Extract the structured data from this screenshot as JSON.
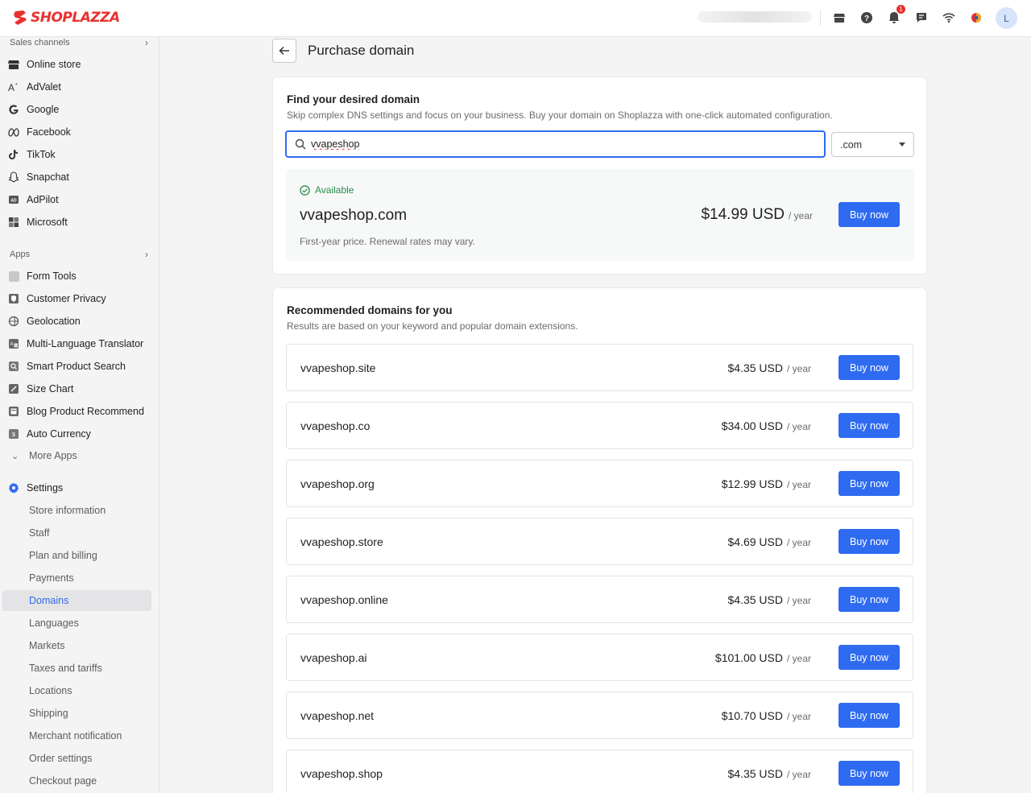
{
  "brand": {
    "name": "SHOPLAZZA",
    "color": "#e8312f"
  },
  "topbar": {
    "icons": [
      "storefront-icon",
      "help-icon",
      "bell-icon",
      "chat-icon",
      "wifi-icon",
      "theme-icon"
    ],
    "notification_count": "1",
    "avatar_initial": "L"
  },
  "sidebar": {
    "sales_channels_label": "Sales channels",
    "channels": [
      {
        "label": "Online store",
        "icon": "storefront-icon"
      },
      {
        "label": "AdValet",
        "icon": "advalet-icon"
      },
      {
        "label": "Google",
        "icon": "google-icon"
      },
      {
        "label": "Facebook",
        "icon": "meta-icon"
      },
      {
        "label": "TikTok",
        "icon": "tiktok-icon"
      },
      {
        "label": "Snapchat",
        "icon": "snapchat-icon"
      },
      {
        "label": "AdPilot",
        "icon": "adpilot-icon"
      },
      {
        "label": "Microsoft",
        "icon": "microsoft-icon"
      }
    ],
    "apps_label": "Apps",
    "apps": [
      {
        "label": "Form Tools"
      },
      {
        "label": "Customer Privacy"
      },
      {
        "label": "Geolocation"
      },
      {
        "label": "Multi-Language Translator"
      },
      {
        "label": "Smart Product Search"
      },
      {
        "label": "Size Chart"
      },
      {
        "label": "Blog Product Recommend"
      },
      {
        "label": "Auto Currency"
      }
    ],
    "more_apps_label": "More Apps",
    "settings_label": "Settings",
    "settings_items": [
      {
        "label": "Store information"
      },
      {
        "label": "Staff"
      },
      {
        "label": "Plan and billing"
      },
      {
        "label": "Payments"
      },
      {
        "label": "Domains",
        "active": true
      },
      {
        "label": "Languages"
      },
      {
        "label": "Markets"
      },
      {
        "label": "Taxes and tariffs"
      },
      {
        "label": "Locations"
      },
      {
        "label": "Shipping"
      },
      {
        "label": "Merchant notification"
      },
      {
        "label": "Order settings"
      },
      {
        "label": "Checkout page"
      }
    ]
  },
  "page": {
    "title": "Purchase domain",
    "find": {
      "title": "Find your desired domain",
      "description": "Skip complex DNS settings and focus on your business. Buy your domain on Shoplazza with one-click automated configuration.",
      "search_value": "vvapeshop",
      "tld_selected": ".com",
      "result": {
        "status": "Available",
        "domain": "vvapeshop.com",
        "price": "$14.99 USD",
        "per": "/ year",
        "note": "First-year price. Renewal rates may vary.",
        "button": "Buy now"
      }
    },
    "recommended": {
      "title": "Recommended domains for you",
      "description": "Results are based on your keyword and popular domain extensions.",
      "per": "/ year",
      "button": "Buy now",
      "items": [
        {
          "domain": "vvapeshop.site",
          "price": "$4.35 USD"
        },
        {
          "domain": "vvapeshop.co",
          "price": "$34.00 USD"
        },
        {
          "domain": "vvapeshop.org",
          "price": "$12.99 USD"
        },
        {
          "domain": "vvapeshop.store",
          "price": "$4.69 USD"
        },
        {
          "domain": "vvapeshop.online",
          "price": "$4.35 USD"
        },
        {
          "domain": "vvapeshop.ai",
          "price": "$101.00 USD"
        },
        {
          "domain": "vvapeshop.net",
          "price": "$10.70 USD"
        },
        {
          "domain": "vvapeshop.shop",
          "price": "$4.35 USD"
        }
      ]
    }
  },
  "colors": {
    "primary": "#2f6bf0",
    "available": "#2a8a4d"
  }
}
